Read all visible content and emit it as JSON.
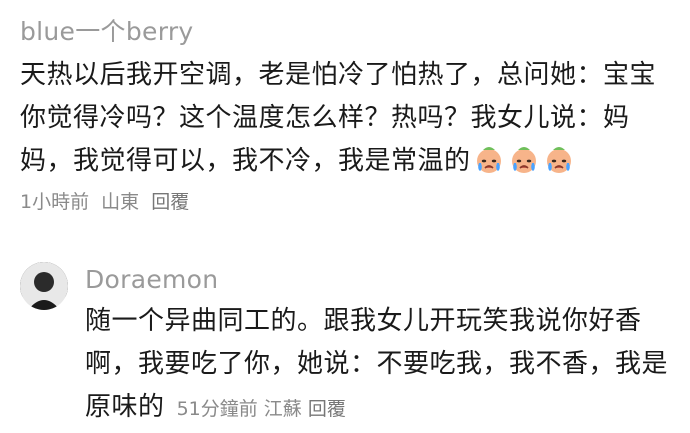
{
  "comments": [
    {
      "username": "blue一个berry",
      "text": "天热以后我开空调，老是怕冷了怕热了，总问她：宝宝你觉得冷吗？这个温度怎么样？热吗？我女儿说：妈妈，我觉得可以，我不冷，我是常温的",
      "emoji_icons": [
        "crying-face-icon",
        "crying-face-icon",
        "crying-face-icon"
      ],
      "time": "1小時前",
      "location": "山東",
      "reply_label": "回覆"
    },
    {
      "username": "Doraemon",
      "text": "随一个异曲同工的。跟我女儿开玩笑我说你好香啊，我要吃了你，她说：不要吃我，我不香，我是原味的",
      "time": "51分鐘前",
      "location": "江蘇",
      "reply_label": "回覆"
    }
  ]
}
